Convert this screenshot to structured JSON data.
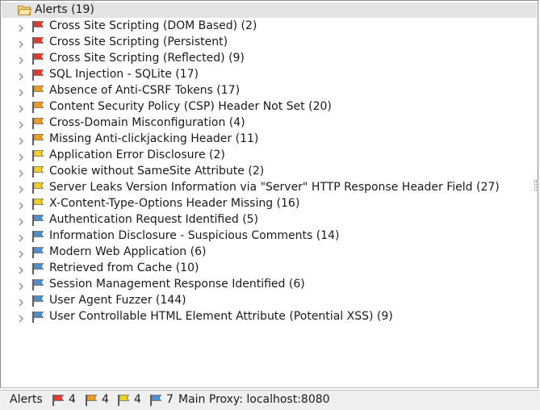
{
  "tree": {
    "root": {
      "label": "Alerts (19)",
      "icon": "folder-open-icon"
    },
    "alerts": [
      {
        "label": "Cross Site Scripting (DOM Based) (2)",
        "risk": "high"
      },
      {
        "label": "Cross Site Scripting (Persistent)",
        "risk": "high"
      },
      {
        "label": "Cross Site Scripting (Reflected) (9)",
        "risk": "high"
      },
      {
        "label": "SQL Injection - SQLite (17)",
        "risk": "high"
      },
      {
        "label": "Absence of Anti-CSRF Tokens (17)",
        "risk": "medium"
      },
      {
        "label": "Content Security Policy (CSP) Header Not Set (20)",
        "risk": "medium"
      },
      {
        "label": "Cross-Domain Misconfiguration (4)",
        "risk": "medium"
      },
      {
        "label": "Missing Anti-clickjacking Header (11)",
        "risk": "medium"
      },
      {
        "label": "Application Error Disclosure (2)",
        "risk": "low"
      },
      {
        "label": "Cookie without SameSite Attribute (2)",
        "risk": "low"
      },
      {
        "label": "Server Leaks Version Information via \"Server\" HTTP Response Header Field (27)",
        "risk": "low"
      },
      {
        "label": "X-Content-Type-Options Header Missing (16)",
        "risk": "low"
      },
      {
        "label": "Authentication Request Identified (5)",
        "risk": "info"
      },
      {
        "label": "Information Disclosure - Suspicious Comments (14)",
        "risk": "info"
      },
      {
        "label": "Modern Web Application (6)",
        "risk": "info"
      },
      {
        "label": "Retrieved from Cache (10)",
        "risk": "info"
      },
      {
        "label": "Session Management Response Identified (6)",
        "risk": "info"
      },
      {
        "label": "User Agent Fuzzer (144)",
        "risk": "info"
      },
      {
        "label": "User Controllable HTML Element Attribute (Potential XSS) (9)",
        "risk": "info"
      }
    ]
  },
  "status_bar": {
    "label": "Alerts",
    "counts": [
      {
        "risk": "high",
        "count": "4"
      },
      {
        "risk": "medium",
        "count": "4"
      },
      {
        "risk": "low",
        "count": "4"
      },
      {
        "risk": "info",
        "count": "7"
      }
    ],
    "proxy": "Main Proxy: localhost:8080"
  },
  "colors": {
    "high": "#e8372a",
    "medium": "#f39a1a",
    "low": "#f2d21b",
    "info": "#4a8fd0",
    "selection": "#e3e3e3"
  }
}
